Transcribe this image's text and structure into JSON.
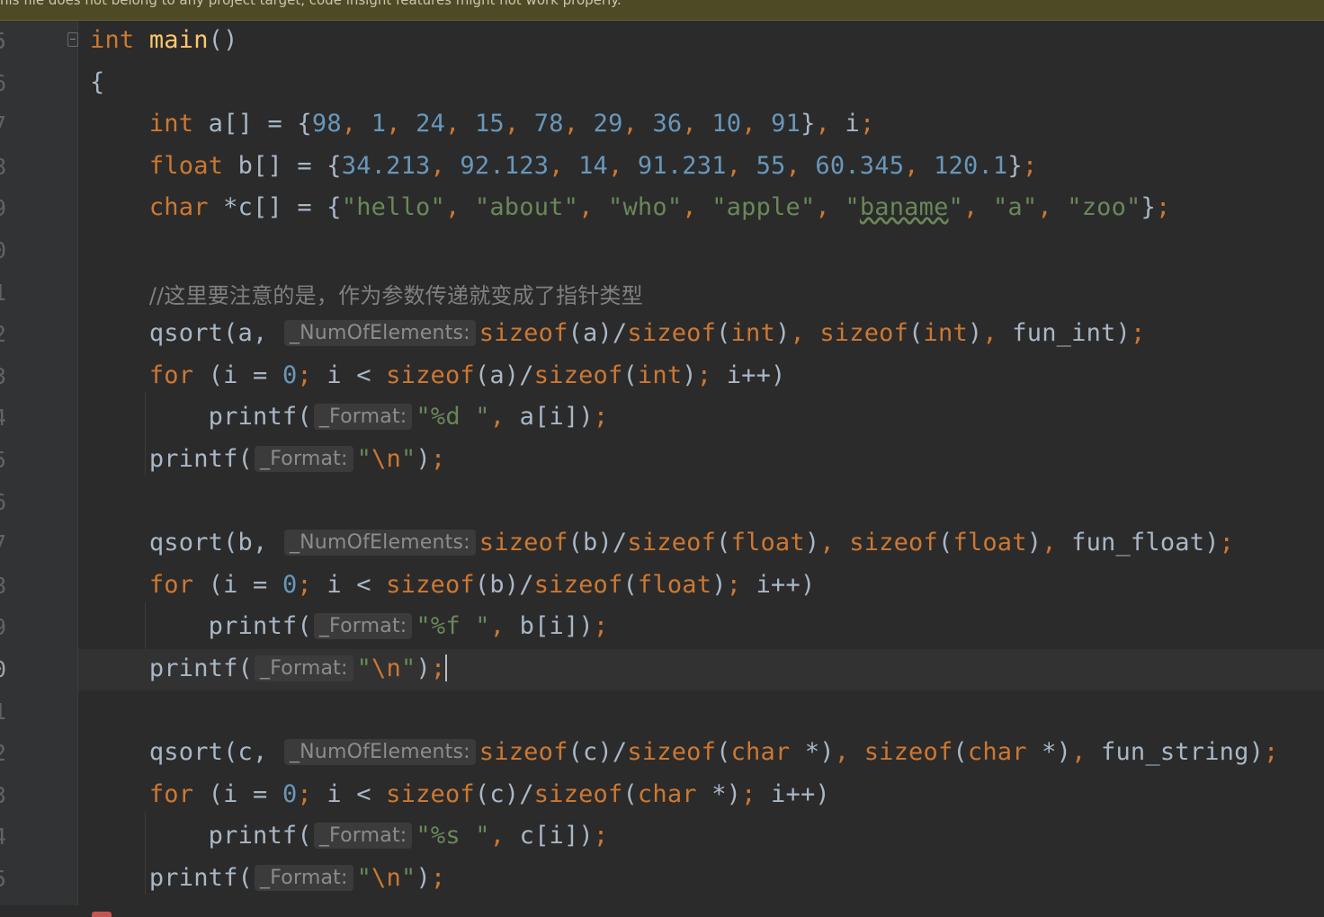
{
  "banner": {
    "text": "his file does not belong to any project target, code insight features might not work properly."
  },
  "editor": {
    "line_numbers": [
      "5",
      "6",
      "7",
      "8",
      "9",
      "0",
      "1",
      "2",
      "3",
      "4",
      "5",
      "6",
      "7",
      "8",
      "9",
      "0",
      "1",
      "2",
      "3",
      "4",
      "5"
    ],
    "current_line_index": 15,
    "lines": [
      {
        "tokens": [
          [
            "kw",
            "int"
          ],
          [
            "t",
            " "
          ],
          [
            "fn",
            "main"
          ],
          [
            "t",
            "()"
          ]
        ]
      },
      {
        "tokens": [
          [
            "t",
            "{"
          ]
        ]
      },
      {
        "tokens": [
          [
            "t",
            "    "
          ],
          [
            "kw",
            "int"
          ],
          [
            "t",
            " a[] = {"
          ],
          [
            "num",
            "98"
          ],
          [
            "punc",
            ", "
          ],
          [
            "num",
            "1"
          ],
          [
            "punc",
            ", "
          ],
          [
            "num",
            "24"
          ],
          [
            "punc",
            ", "
          ],
          [
            "num",
            "15"
          ],
          [
            "punc",
            ", "
          ],
          [
            "num",
            "78"
          ],
          [
            "punc",
            ", "
          ],
          [
            "num",
            "29"
          ],
          [
            "punc",
            ", "
          ],
          [
            "num",
            "36"
          ],
          [
            "punc",
            ", "
          ],
          [
            "num",
            "10"
          ],
          [
            "punc",
            ", "
          ],
          [
            "num",
            "91"
          ],
          [
            "t",
            "}"
          ],
          [
            "punc",
            ", "
          ],
          [
            "t",
            "i"
          ],
          [
            "punc",
            ";"
          ]
        ]
      },
      {
        "tokens": [
          [
            "t",
            "    "
          ],
          [
            "kw",
            "float"
          ],
          [
            "t",
            " b[] = {"
          ],
          [
            "num",
            "34.213"
          ],
          [
            "punc",
            ", "
          ],
          [
            "num",
            "92.123"
          ],
          [
            "punc",
            ", "
          ],
          [
            "num",
            "14"
          ],
          [
            "punc",
            ", "
          ],
          [
            "num",
            "91.231"
          ],
          [
            "punc",
            ", "
          ],
          [
            "num",
            "55"
          ],
          [
            "punc",
            ", "
          ],
          [
            "num",
            "60.345"
          ],
          [
            "punc",
            ", "
          ],
          [
            "num",
            "120.1"
          ],
          [
            "t",
            "}"
          ],
          [
            "punc",
            ";"
          ]
        ]
      },
      {
        "tokens": [
          [
            "t",
            "    "
          ],
          [
            "kw",
            "char"
          ],
          [
            "t",
            " *c[] = {"
          ],
          [
            "str",
            "\"hello\""
          ],
          [
            "punc",
            ", "
          ],
          [
            "str",
            "\"about\""
          ],
          [
            "punc",
            ", "
          ],
          [
            "str",
            "\"who\""
          ],
          [
            "punc",
            ", "
          ],
          [
            "str",
            "\"apple\""
          ],
          [
            "punc",
            ", "
          ],
          [
            "str",
            "\""
          ],
          [
            "typo",
            "baname"
          ],
          [
            "str",
            "\""
          ],
          [
            "punc",
            ", "
          ],
          [
            "str",
            "\"a\""
          ],
          [
            "punc",
            ", "
          ],
          [
            "str",
            "\"zoo\""
          ],
          [
            "t",
            "}"
          ],
          [
            "punc",
            ";"
          ]
        ]
      },
      {
        "tokens": []
      },
      {
        "tokens": [
          [
            "t",
            "    "
          ],
          [
            "cm",
            "//这里要注意的是，作为参数传递就变成了指针类型"
          ]
        ]
      },
      {
        "tokens": [
          [
            "t",
            "    "
          ],
          [
            "t",
            "qsort(a, "
          ],
          [
            "hint",
            "_NumOfElements:"
          ],
          [
            "kw",
            "sizeof"
          ],
          [
            "t",
            "(a)/"
          ],
          [
            "kw",
            "sizeof"
          ],
          [
            "t",
            "("
          ],
          [
            "kw",
            "int"
          ],
          [
            "t",
            ")"
          ],
          [
            "punc",
            ", "
          ],
          [
            "kw",
            "sizeof"
          ],
          [
            "t",
            "("
          ],
          [
            "kw",
            "int"
          ],
          [
            "t",
            ")"
          ],
          [
            "punc",
            ", "
          ],
          [
            "t",
            "fun_int)"
          ],
          [
            "punc",
            ";"
          ]
        ]
      },
      {
        "tokens": [
          [
            "t",
            "    "
          ],
          [
            "kw",
            "for"
          ],
          [
            "t",
            " (i = "
          ],
          [
            "num",
            "0"
          ],
          [
            "punc",
            "; "
          ],
          [
            "t",
            "i < "
          ],
          [
            "kw",
            "sizeof"
          ],
          [
            "t",
            "(a)/"
          ],
          [
            "kw",
            "sizeof"
          ],
          [
            "t",
            "("
          ],
          [
            "kw",
            "int"
          ],
          [
            "t",
            ")"
          ],
          [
            "punc",
            "; "
          ],
          [
            "t",
            "i++)"
          ]
        ]
      },
      {
        "tokens": [
          [
            "t",
            "        "
          ],
          [
            "t",
            "printf("
          ],
          [
            "hint",
            "_Format:"
          ],
          [
            "str",
            "\"%d \""
          ],
          [
            "punc",
            ", "
          ],
          [
            "t",
            "a[i])"
          ],
          [
            "punc",
            ";"
          ]
        ]
      },
      {
        "tokens": [
          [
            "t",
            "    "
          ],
          [
            "t",
            "printf("
          ],
          [
            "hint",
            "_Format:"
          ],
          [
            "str",
            "\""
          ],
          [
            "esc",
            "\\n"
          ],
          [
            "str",
            "\""
          ],
          [
            "t",
            ")"
          ],
          [
            "punc",
            ";"
          ]
        ]
      },
      {
        "tokens": []
      },
      {
        "tokens": [
          [
            "t",
            "    "
          ],
          [
            "t",
            "qsort(b, "
          ],
          [
            "hint",
            "_NumOfElements:"
          ],
          [
            "kw",
            "sizeof"
          ],
          [
            "t",
            "(b)/"
          ],
          [
            "kw",
            "sizeof"
          ],
          [
            "t",
            "("
          ],
          [
            "kw",
            "float"
          ],
          [
            "t",
            ")"
          ],
          [
            "punc",
            ", "
          ],
          [
            "kw",
            "sizeof"
          ],
          [
            "t",
            "("
          ],
          [
            "kw",
            "float"
          ],
          [
            "t",
            ")"
          ],
          [
            "punc",
            ", "
          ],
          [
            "t",
            "fun_float)"
          ],
          [
            "punc",
            ";"
          ]
        ]
      },
      {
        "tokens": [
          [
            "t",
            "    "
          ],
          [
            "kw",
            "for"
          ],
          [
            "t",
            " (i = "
          ],
          [
            "num",
            "0"
          ],
          [
            "punc",
            "; "
          ],
          [
            "t",
            "i < "
          ],
          [
            "kw",
            "sizeof"
          ],
          [
            "t",
            "(b)/"
          ],
          [
            "kw",
            "sizeof"
          ],
          [
            "t",
            "("
          ],
          [
            "kw",
            "float"
          ],
          [
            "t",
            ")"
          ],
          [
            "punc",
            "; "
          ],
          [
            "t",
            "i++)"
          ]
        ]
      },
      {
        "tokens": [
          [
            "t",
            "        "
          ],
          [
            "t",
            "printf("
          ],
          [
            "hint",
            "_Format:"
          ],
          [
            "str",
            "\"%f \""
          ],
          [
            "punc",
            ", "
          ],
          [
            "t",
            "b[i])"
          ],
          [
            "punc",
            ";"
          ]
        ]
      },
      {
        "tokens": [
          [
            "t",
            "    "
          ],
          [
            "t",
            "printf("
          ],
          [
            "hint",
            "_Format:"
          ],
          [
            "str",
            "\""
          ],
          [
            "esc",
            "\\n"
          ],
          [
            "str",
            "\""
          ],
          [
            "t",
            ")"
          ],
          [
            "punc",
            ";"
          ],
          [
            "caret",
            ""
          ]
        ]
      },
      {
        "tokens": []
      },
      {
        "tokens": [
          [
            "t",
            "    "
          ],
          [
            "t",
            "qsort(c, "
          ],
          [
            "hint",
            "_NumOfElements:"
          ],
          [
            "kw",
            "sizeof"
          ],
          [
            "t",
            "(c)/"
          ],
          [
            "kw",
            "sizeof"
          ],
          [
            "t",
            "("
          ],
          [
            "kw",
            "char"
          ],
          [
            "t",
            " *)"
          ],
          [
            "punc",
            ", "
          ],
          [
            "kw",
            "sizeof"
          ],
          [
            "t",
            "("
          ],
          [
            "kw",
            "char"
          ],
          [
            "t",
            " *)"
          ],
          [
            "punc",
            ", "
          ],
          [
            "t",
            "fun_string)"
          ],
          [
            "punc",
            ";"
          ]
        ]
      },
      {
        "tokens": [
          [
            "t",
            "    "
          ],
          [
            "kw",
            "for"
          ],
          [
            "t",
            " (i = "
          ],
          [
            "num",
            "0"
          ],
          [
            "punc",
            "; "
          ],
          [
            "t",
            "i < "
          ],
          [
            "kw",
            "sizeof"
          ],
          [
            "t",
            "(c)/"
          ],
          [
            "kw",
            "sizeof"
          ],
          [
            "t",
            "("
          ],
          [
            "kw",
            "char"
          ],
          [
            "t",
            " *)"
          ],
          [
            "punc",
            "; "
          ],
          [
            "t",
            "i++)"
          ]
        ]
      },
      {
        "tokens": [
          [
            "t",
            "        "
          ],
          [
            "t",
            "printf("
          ],
          [
            "hint",
            "_Format:"
          ],
          [
            "str",
            "\"%s \""
          ],
          [
            "punc",
            ", "
          ],
          [
            "t",
            "c[i])"
          ],
          [
            "punc",
            ";"
          ]
        ]
      },
      {
        "tokens": [
          [
            "t",
            "    "
          ],
          [
            "t",
            "printf("
          ],
          [
            "hint",
            "_Format:"
          ],
          [
            "str",
            "\""
          ],
          [
            "esc",
            "\\n"
          ],
          [
            "str",
            "\""
          ],
          [
            "t",
            ")"
          ],
          [
            "punc",
            ";"
          ]
        ]
      }
    ]
  },
  "colors": {
    "background": "#2b2b2b",
    "keyword": "#cc7832",
    "number": "#6897bb",
    "string": "#6a8759",
    "comment": "#808080",
    "text": "#a9b7c6",
    "banner": "#4d4a25"
  }
}
